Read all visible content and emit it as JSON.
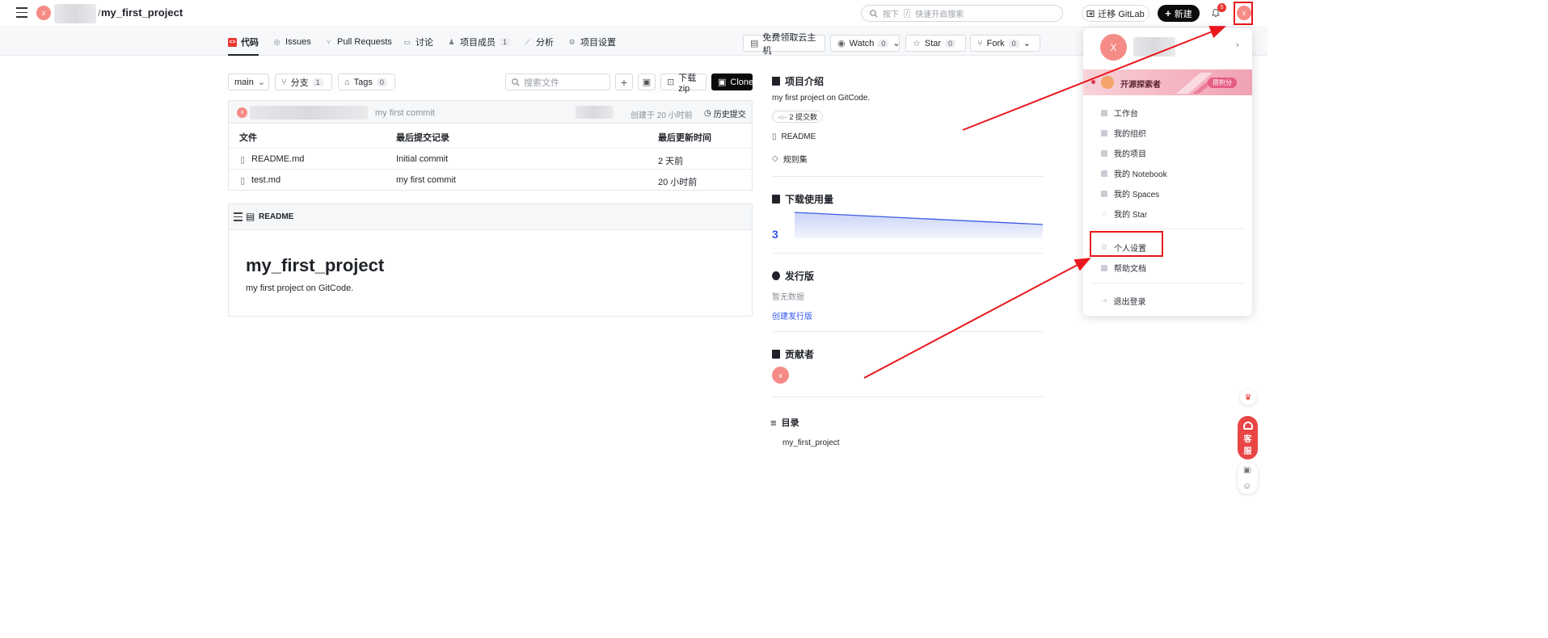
{
  "header": {
    "avatar_letter": "x",
    "separator": "/",
    "project_name": "my_first_project",
    "search_placeholder_prefix": "按下",
    "search_key": "/",
    "search_placeholder_suffix": "快速开启搜索",
    "migrate_label": "迁移 GitLab",
    "new_label": "新建",
    "notifications_count": "5"
  },
  "tabs": [
    {
      "label": "代码"
    },
    {
      "label": "Issues"
    },
    {
      "label": "Pull Requests"
    },
    {
      "label": "讨论"
    },
    {
      "label": "项目成员",
      "count": "1"
    },
    {
      "label": "分析"
    },
    {
      "label": "项目设置"
    }
  ],
  "repo_actions": {
    "cloud_host": "免费领取云主机",
    "watch": "Watch",
    "watch_count": "0",
    "star": "Star",
    "star_count": "0",
    "fork": "Fork",
    "fork_count": "0"
  },
  "toolbar": {
    "branch": "main",
    "branches_label": "分支",
    "branches_count": "1",
    "tags_label": "Tags",
    "tags_count": "0",
    "search_files_placeholder": "搜索文件",
    "download_label": "下载zip",
    "clone_label": "Clone"
  },
  "commit": {
    "avatar_letter": "x",
    "message": "my first commit",
    "created": "创建于 20 小时前",
    "history": "历史提交"
  },
  "files": {
    "headers": [
      "文件",
      "最后提交记录",
      "最后更新时间"
    ],
    "rows": [
      {
        "name": "README.md",
        "commit": "Initial commit",
        "time": "2 天前"
      },
      {
        "name": "test.md",
        "commit": "my first commit",
        "time": "20 小时前"
      }
    ]
  },
  "readme": {
    "header_label": "README",
    "title": "my_first_project",
    "body": "my first project on GitCode."
  },
  "sidebar": {
    "intro_title": "项目介绍",
    "intro_desc": "my first project on GitCode.",
    "commits_badge": "2 提交数",
    "readme_link": "README",
    "rules_link": "规则集",
    "downloads_title": "下载使用量",
    "downloads_value": "3",
    "releases_title": "发行版",
    "releases_empty": "暂无数据",
    "releases_create": "创建发行版",
    "contributors_title": "贡献者",
    "contributor_letter": "x",
    "toc_title": "目录",
    "toc_item": "my_first_project"
  },
  "dropdown": {
    "avatar_letter": "X",
    "banner_text": "开源探索者",
    "banner_badge": "攒积分",
    "items": [
      {
        "label": "工作台"
      },
      {
        "label": "我的组织"
      },
      {
        "label": "我的项目"
      },
      {
        "label": "我的 Notebook"
      },
      {
        "label": "我的 Spaces"
      },
      {
        "label": "我的 Star"
      },
      {
        "label": "个人设置"
      },
      {
        "label": "帮助文档"
      },
      {
        "label": "退出登录"
      }
    ]
  },
  "floating": {
    "service_label_1": "客",
    "service_label_2": "服"
  },
  "colors": {
    "accent_blue": "#2f54eb",
    "annotation_red": "#e8171d",
    "avatar_pink": "#f58b86"
  }
}
